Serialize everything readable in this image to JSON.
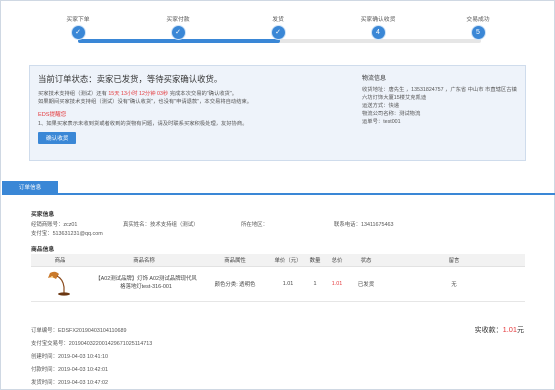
{
  "steps": [
    {
      "label": "买家下单",
      "mark": "✓"
    },
    {
      "label": "买家付款",
      "mark": "✓"
    },
    {
      "label": "发货",
      "mark": "✓"
    },
    {
      "label": "买家确认收货",
      "mark": "4"
    },
    {
      "label": "交易成功",
      "mark": "5"
    }
  ],
  "progress_completed_steps": 3,
  "status": {
    "title": "当前订单状态：卖家已发货，等待买家确认收货。",
    "line1_prefix": "买家技术支持组（测试）还有",
    "days": "15天",
    "hours": "13小时",
    "minutes": "12分钟",
    "seconds": "03秒",
    "line1_suffix": "完成本次交易的\"确认收货\"。",
    "line2": "如果期间买家技术支持组（测试）没有\"确认收货\"，也没有\"申请退款\"，本交易将自动结束。",
    "warn": "EDS提醒您",
    "line3": "1、如果买家表示未收到货或者收到的货物有问题，请及时联系买家积极处理，友好协商。",
    "confirm_button": "确认收货"
  },
  "logistics": {
    "title": "物流信息",
    "address": "收货地址：唐先生 ，13531824757 ，广东省 中山市 市直辖区古镇六坊灯饰大厦15楼艾克凯迪",
    "method": "运送方式：快递",
    "company": "物流公司名称：测试物流",
    "waybill": "运单号：test001"
  },
  "tab": {
    "label": "订单信息"
  },
  "buyer": {
    "title": "买家信息",
    "account": "经销商账号：zcz01",
    "name": "真实姓名：技术支持组（测试）",
    "region": "所在地区：",
    "phone": "联系电话：13411675463",
    "alipay": "支付宝：513631231@qq.com"
  },
  "goods": {
    "title": "商品信息",
    "headers": [
      "商品",
      "商品名称",
      "商品属性",
      "单价（元）",
      "数量",
      "总价",
      "状态",
      "留言"
    ],
    "row": {
      "name": "【A02测试品牌】灯饰 A02测试品牌现代风格落地灯test-316-001",
      "attr": "颜色分类: 透明色",
      "price": "1.01",
      "qty": "1",
      "total": "1.01",
      "status": "已发货",
      "remark": "无"
    }
  },
  "order": {
    "number": "订单编号：EDSFX20190403104110689",
    "alipay_trade": "支付宝交易号：2019040322001429671025114713",
    "created": "创建时间：2019-04-03 10:41:10",
    "paid": "付款时间：2019-04-03 10:42:01",
    "shipped": "发货时间：2019-04-03 10:47:02"
  },
  "amount": {
    "label": "实收款：",
    "value": "1.01",
    "unit": "元"
  },
  "colors": {
    "accent": "#3a87d6",
    "warn": "#e4393c",
    "panel": "#eef3fa"
  }
}
